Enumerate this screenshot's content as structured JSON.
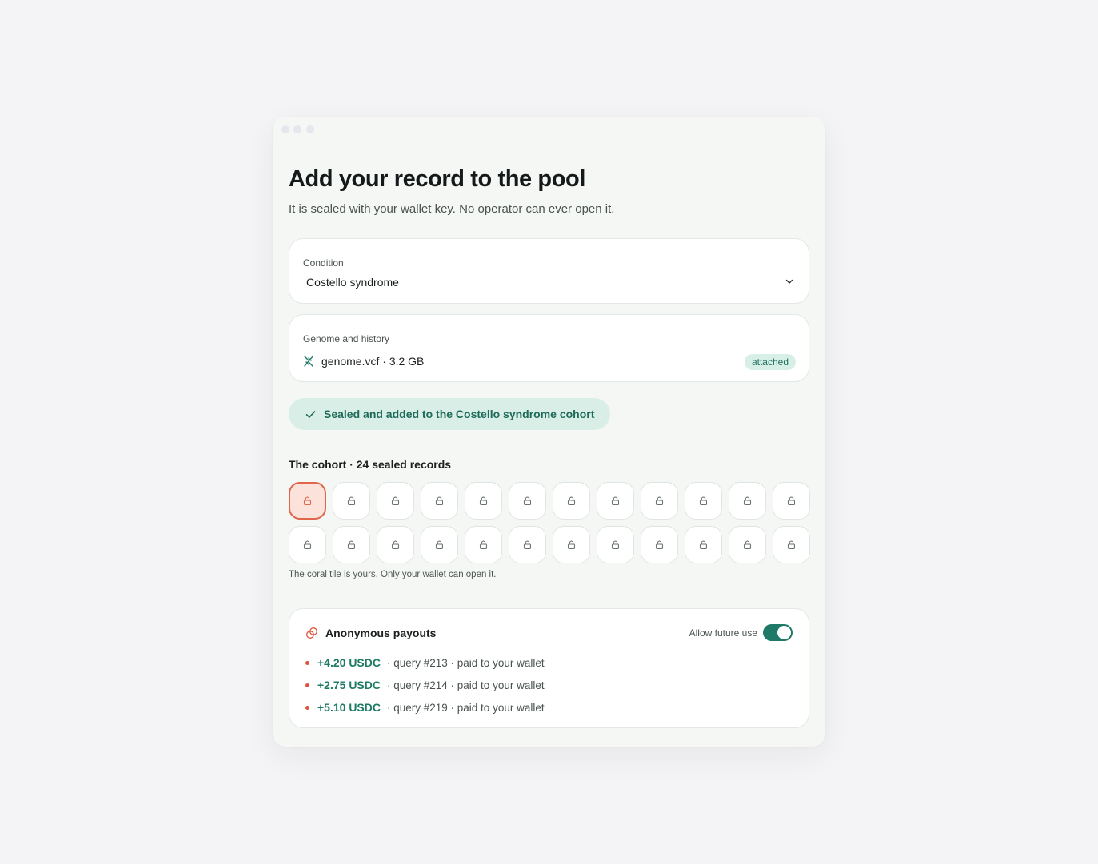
{
  "page": {
    "title": "Add your record to the pool",
    "subtitle": "It is sealed with your wallet key. No operator can ever open it."
  },
  "condition": {
    "label": "Condition",
    "value": "Costello syndrome",
    "icon": "chevron-down-icon"
  },
  "genome": {
    "label": "Genome and history",
    "file": "genome.vcf · 3.2 GB",
    "badge": "attached",
    "icon": "dna-icon"
  },
  "status": {
    "text": "Sealed and added to the Costello syndrome cohort",
    "icon": "check-icon"
  },
  "cohort": {
    "title": "The cohort · 24 sealed records",
    "tile_count": 24,
    "my_tile_index": 0,
    "note": "The coral tile is yours. Only your wallet can open it.",
    "icon": "lock-icon"
  },
  "payouts": {
    "title": "Anonymous payouts",
    "icon": "coins-icon",
    "toggle_label": "Allow future use",
    "toggle_on": true,
    "items": [
      {
        "amount": "+4.20 USDC",
        "detail": "· query #213 · paid to your wallet"
      },
      {
        "amount": "+2.75 USDC",
        "detail": "· query #214 · paid to your wallet"
      },
      {
        "amount": "+5.10 USDC",
        "detail": "· query #219 · paid to your wallet"
      }
    ]
  },
  "colors": {
    "accent": "#1e7a66",
    "coral": "#e0654a",
    "pill_bg": "#d9eee6"
  }
}
